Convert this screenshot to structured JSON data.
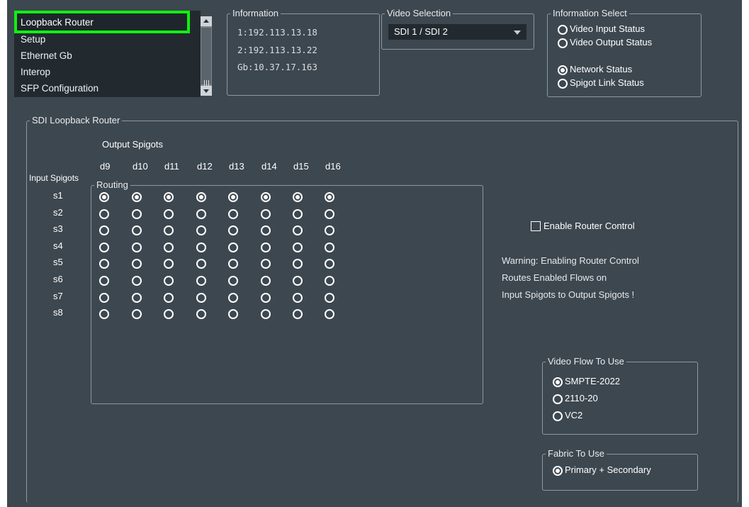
{
  "nav": {
    "items": [
      "Loopback Router",
      "Setup",
      "Ethernet Gb",
      "Interop",
      "SFP Configuration"
    ],
    "selected": 0
  },
  "information": {
    "title": "Information",
    "lines": [
      "1:192.113.13.18",
      "2:192.113.13.22",
      "Gb:10.37.17.163"
    ]
  },
  "video_selection": {
    "title": "Video Selection",
    "value": "SDI 1 / SDI 2"
  },
  "information_select": {
    "title": "Information Select",
    "options": [
      {
        "label": "Video Input Status",
        "selected": false
      },
      {
        "label": "Video Output Status",
        "selected": false
      },
      {
        "label": "Network Status",
        "selected": true
      },
      {
        "label": "Spigot Link Status",
        "selected": false
      }
    ]
  },
  "router": {
    "title": "SDI Loopback Router",
    "output_spigots_label": "Output Spigots",
    "input_spigots_label": "Input Spigots",
    "routing_label": "Routing",
    "outputs": [
      "d9",
      "d10",
      "d11",
      "d12",
      "d13",
      "d14",
      "d15",
      "d16"
    ],
    "inputs": [
      "s1",
      "s2",
      "s3",
      "s4",
      "s5",
      "s6",
      "s7",
      "s8"
    ],
    "selected_input_row": 0,
    "enable_router_control": {
      "label": "Enable Router Control",
      "checked": false
    },
    "warning_lines": [
      "Warning: Enabling Router Control",
      "Routes Enabled Flows on",
      "Input Spigots to Output Spigots !"
    ]
  },
  "video_flow": {
    "title": "Video Flow To Use",
    "options": [
      {
        "label": "SMPTE-2022",
        "selected": true
      },
      {
        "label": "2110-20",
        "selected": false
      },
      {
        "label": "VC2",
        "selected": false
      }
    ]
  },
  "fabric": {
    "title": "Fabric To Use",
    "options": [
      {
        "label": "Primary + Secondary",
        "selected": true
      }
    ]
  },
  "colors": {
    "background": "#3d474f",
    "list_background": "#222a30",
    "highlight": "#10f010",
    "border": "#8e989f"
  }
}
